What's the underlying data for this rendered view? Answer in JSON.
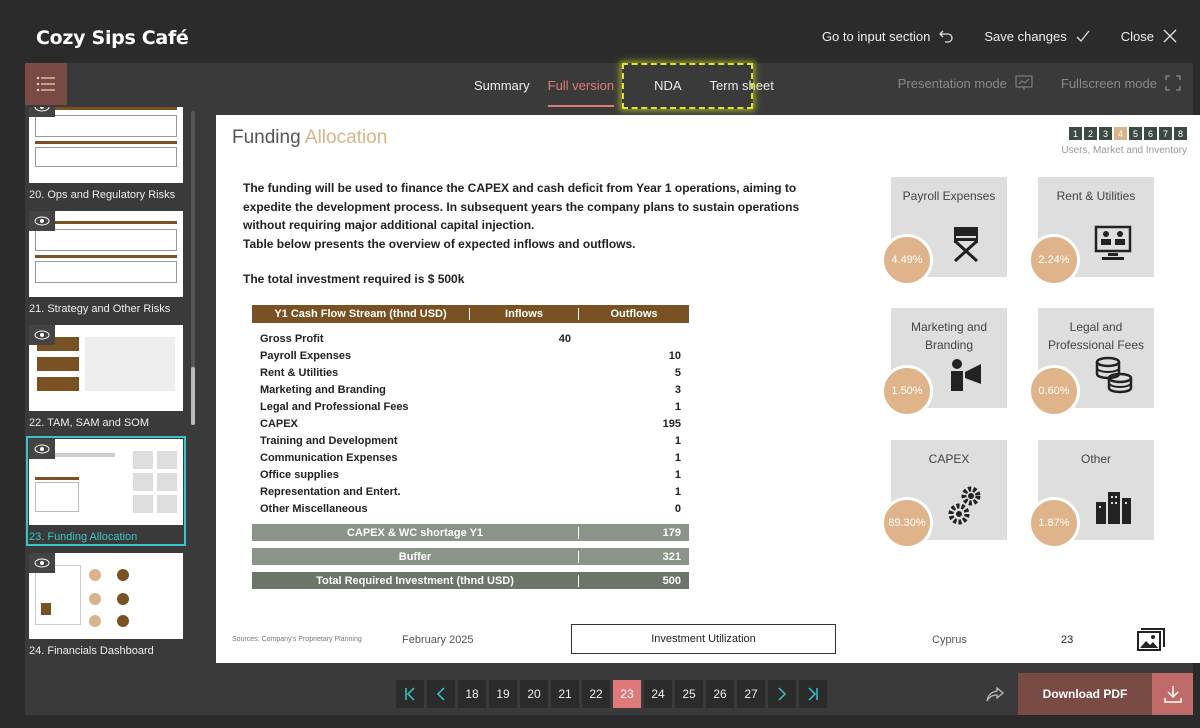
{
  "app": {
    "title": "Cozy Sips Café",
    "actions": [
      {
        "label": "Go to input section",
        "icon": "undo-arrow-icon"
      },
      {
        "label": "Save changes",
        "icon": "checkmark-icon"
      },
      {
        "label": "Close",
        "icon": "close-icon"
      }
    ]
  },
  "tabs": [
    {
      "label": "Summary",
      "active": false
    },
    {
      "label": "Full version",
      "active": true
    },
    {
      "label": "NDA",
      "active": false
    },
    {
      "label": "Term sheet",
      "active": false
    }
  ],
  "modes": [
    {
      "label": "Presentation mode",
      "icon": "presentation-icon"
    },
    {
      "label": "Fullscreen mode",
      "icon": "fullscreen-icon"
    }
  ],
  "sidebar": {
    "items": [
      {
        "label": "20. Ops and Regulatory Risks"
      },
      {
        "label": "21. Strategy and Other Risks"
      },
      {
        "label": "22. TAM, SAM and SOM"
      },
      {
        "label": "23. Funding Allocation",
        "active": true
      },
      {
        "label": "24. Financials Dashboard"
      }
    ]
  },
  "slide": {
    "title_main": "Funding",
    "title_accent": "Allocation",
    "pager": [
      "1",
      "2",
      "3",
      "4",
      "5",
      "6",
      "7",
      "8"
    ],
    "pager_current": "4",
    "pager_caption": "Users, Market and Inventory",
    "intro": "The funding will be used to finance the CAPEX and cash deficit from Year 1 operations, aiming to expedite the development process. In subsequent years the company plans to sustain operations without requiring major additional capital injection.",
    "intro2": "Table below presents the overview of expected inflows and outflows.",
    "total_line": "The total investment required is $ 500k",
    "table": {
      "headers": [
        "Y1 Cash Flow Stream (thnd USD)",
        "Inflows",
        "Outflows"
      ],
      "rows": [
        {
          "name": "Gross Profit",
          "inflow": "40",
          "outflow": ""
        },
        {
          "name": "Payroll Expenses",
          "inflow": "",
          "outflow": "10"
        },
        {
          "name": "Rent & Utilities",
          "inflow": "",
          "outflow": "5"
        },
        {
          "name": "Marketing and Branding",
          "inflow": "",
          "outflow": "3"
        },
        {
          "name": "Legal and Professional Fees",
          "inflow": "",
          "outflow": "1"
        },
        {
          "name": "CAPEX",
          "inflow": "",
          "outflow": "195"
        },
        {
          "name": "Training and Development",
          "inflow": "",
          "outflow": "1"
        },
        {
          "name": "Communication Expenses",
          "inflow": "",
          "outflow": "1"
        },
        {
          "name": "Office supplies",
          "inflow": "",
          "outflow": "1"
        },
        {
          "name": "Representation and Entert.",
          "inflow": "",
          "outflow": "1"
        },
        {
          "name": "Other Miscellaneous",
          "inflow": "",
          "outflow": "0"
        }
      ],
      "summary": [
        {
          "name": "CAPEX & WC shortage Y1",
          "value": "179"
        },
        {
          "name": "Buffer",
          "value": "321"
        },
        {
          "name": "Total Required Investment (thnd USD)",
          "value": "500"
        }
      ]
    },
    "cards": [
      {
        "title": "Payroll Expenses",
        "pct": "4.49%",
        "icon": "director-chair-icon"
      },
      {
        "title": "Rent & Utilities",
        "pct": "2.24%",
        "icon": "video-meeting-icon"
      },
      {
        "title": "Marketing and Branding",
        "pct": "1.50%",
        "icon": "megaphone-person-icon"
      },
      {
        "title": "Legal and Professional Fees",
        "pct": "0.60%",
        "icon": "coins-stack-icon"
      },
      {
        "title": "CAPEX",
        "pct": "89.30%",
        "icon": "gears-icon"
      },
      {
        "title": "Other",
        "pct": "1.87%",
        "icon": "buildings-icon"
      }
    ],
    "footer": {
      "source": "Sources: Company's Proprietary Planning",
      "date": "February 2025",
      "button": "Investment Utilization",
      "country": "Cyprus",
      "page": "23"
    }
  },
  "pagination": {
    "pages": [
      "18",
      "19",
      "20",
      "21",
      "22",
      "23",
      "24",
      "25",
      "26",
      "27"
    ],
    "current": "23"
  },
  "download_label": "Download PDF",
  "colors": {
    "accent_red": "#e07a7a",
    "brown": "#7a5122",
    "tan": "#e0b48a",
    "teal": "#3cc3c8",
    "highlight": "#dfe32a"
  }
}
